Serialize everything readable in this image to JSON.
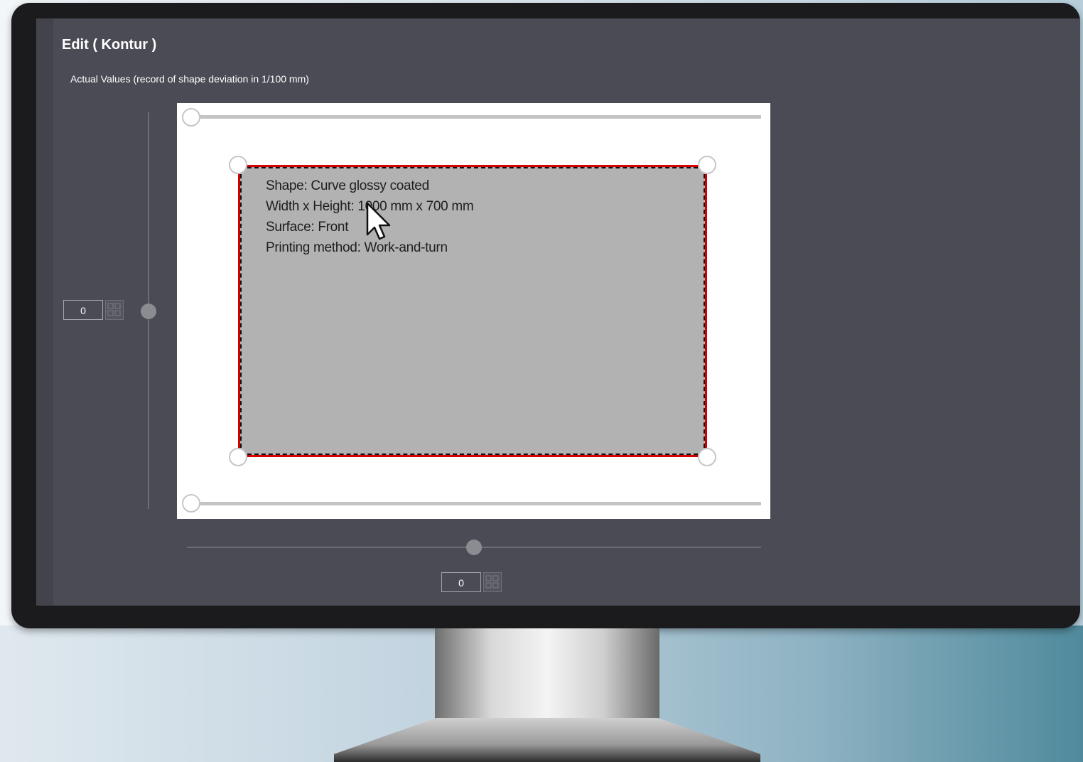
{
  "window": {
    "title": "Edit ( Kontur )",
    "subtitle": "Actual Values (record of shape deviation in 1/100 mm)"
  },
  "shape_info": {
    "shape": "Shape: Curve glossy coated",
    "dimensions": "Width x Height: 1000 mm x 700 mm",
    "surface": "Surface: Front",
    "printing_method": "Printing method: Work-and-turn"
  },
  "vertical_control": {
    "value": "0"
  },
  "horizontal_control": {
    "value": "0"
  },
  "colors": {
    "screen_bg": "#4b4b55",
    "contour_outline": "#d40000",
    "shape_fill": "#b2b2b2"
  }
}
